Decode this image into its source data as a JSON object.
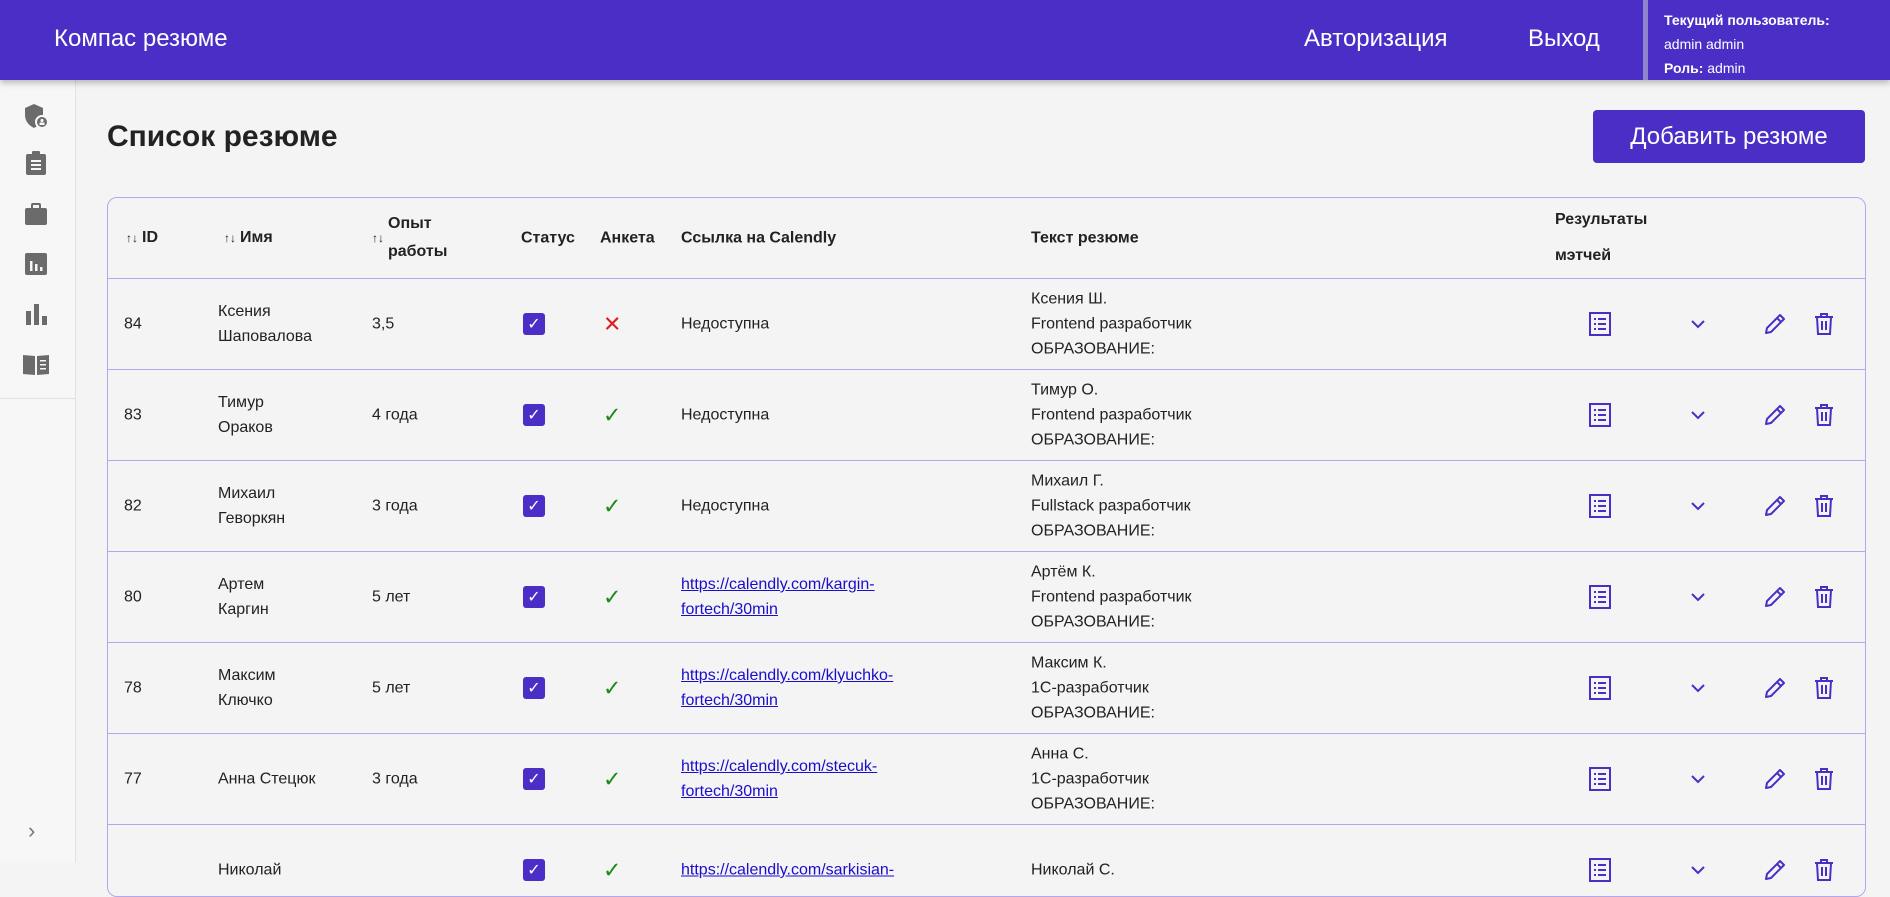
{
  "header": {
    "brand": "Компас резюме",
    "auth": "Авторизация",
    "logout": "Выход",
    "current_user_label": "Текущий пользователь:",
    "current_user": "admin admin",
    "role_label": "Роль:",
    "role": "admin"
  },
  "sidebar": {
    "icons": [
      "shield-user-icon",
      "clipboard-icon",
      "briefcase-icon",
      "report-icon",
      "bar-chart-icon",
      "book-icon"
    ],
    "expand": "›"
  },
  "page": {
    "title": "Список резюме",
    "add_button": "Добавить резюме"
  },
  "table": {
    "headers": {
      "id": "ID",
      "name": "Имя",
      "exp": "Опыт работы",
      "status": "Статус",
      "form": "Анкета",
      "calendly": "Ссылка на Calendly",
      "text": "Текст резюме",
      "results": "Результаты мэтчей",
      "sort": "↑↓"
    },
    "rows": [
      {
        "id": "84",
        "name1": "Ксения",
        "name2": "Шаповалова",
        "exp": "3,5",
        "form": false,
        "link1": "Недоступна",
        "link2": "",
        "is_link": false,
        "t1": "Ксения Ш.",
        "t2": "Frontend разработчик",
        "t3": "ОБРАЗОВАНИЕ:"
      },
      {
        "id": "83",
        "name1": "Тимур",
        "name2": "Ораков",
        "exp": "4 года",
        "form": true,
        "link1": "Недоступна",
        "link2": "",
        "is_link": false,
        "t1": "Тимур О.",
        "t2": "Frontend разработчик",
        "t3": "ОБРАЗОВАНИЕ:"
      },
      {
        "id": "82",
        "name1": "Михаил",
        "name2": "Геворкян",
        "exp": "3 года",
        "form": true,
        "link1": "Недоступна",
        "link2": "",
        "is_link": false,
        "t1": "Михаил Г.",
        "t2": "Fullstack разработчик",
        "t3": "ОБРАЗОВАНИЕ:"
      },
      {
        "id": "80",
        "name1": "Артем",
        "name2": "Каргин",
        "exp": "5 лет",
        "form": true,
        "link1": "https://calendly.com/kargin-",
        "link2": "fortech/30min",
        "is_link": true,
        "t1": "Артём К.",
        "t2": "Frontend разработчик",
        "t3": "ОБРАЗОВАНИЕ:"
      },
      {
        "id": "78",
        "name1": "Максим",
        "name2": "Ключко",
        "exp": "5 лет",
        "form": true,
        "link1": "https://calendly.com/klyuchko-",
        "link2": "fortech/30min",
        "is_link": true,
        "t1": "Максим К.",
        "t2": "1С-разработчик",
        "t3": "ОБРАЗОВАНИЕ:"
      },
      {
        "id": "77",
        "name1": "Анна Стецюк",
        "name2": "",
        "exp": "3 года",
        "form": true,
        "link1": "https://calendly.com/stecuk-",
        "link2": "fortech/30min",
        "is_link": true,
        "t1": "Анна С.",
        "t2": "1С-разработчик",
        "t3": "ОБРАЗОВАНИЕ:"
      },
      {
        "id": "",
        "name1": "Николай",
        "name2": "",
        "exp": "",
        "form": true,
        "link1": "https://calendly.com/sarkisian-",
        "link2": "",
        "is_link": true,
        "t1": "Николай С.",
        "t2": "",
        "t3": ""
      }
    ]
  }
}
